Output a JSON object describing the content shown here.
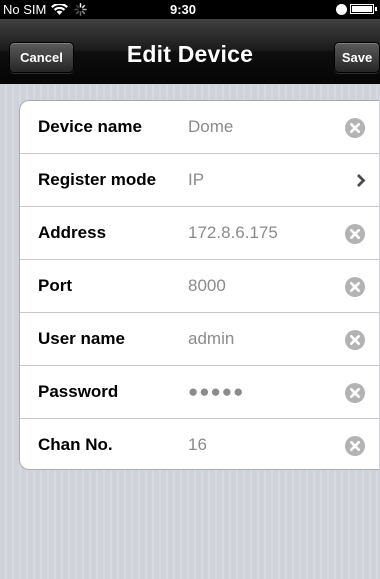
{
  "status_bar": {
    "carrier": "No SIM",
    "time": "9:30",
    "icons": [
      "wifi-icon",
      "activity-spinner-icon",
      "lock-icon",
      "battery-icon"
    ]
  },
  "nav": {
    "title": "Edit Device",
    "cancel_label": "Cancel",
    "save_label": "Save"
  },
  "fields": [
    {
      "label": "Device name",
      "value": "Dome",
      "accessory": "clear"
    },
    {
      "label": "Register mode",
      "value": "IP",
      "accessory": "chevron"
    },
    {
      "label": "Address",
      "value": "172.8.6.175",
      "accessory": "clear"
    },
    {
      "label": "Port",
      "value": "8000",
      "accessory": "clear"
    },
    {
      "label": "User name",
      "value": "admin",
      "accessory": "clear"
    },
    {
      "label": "Password",
      "value": "●●●●●",
      "accessory": "clear"
    },
    {
      "label": "Chan No.",
      "value": "16",
      "accessory": "clear"
    }
  ],
  "colors": {
    "nav_bar": "#1b1b1b",
    "background": "#d1d4da",
    "value_text": "#8b8b8b",
    "clear_icon": "#b3b3b3"
  }
}
